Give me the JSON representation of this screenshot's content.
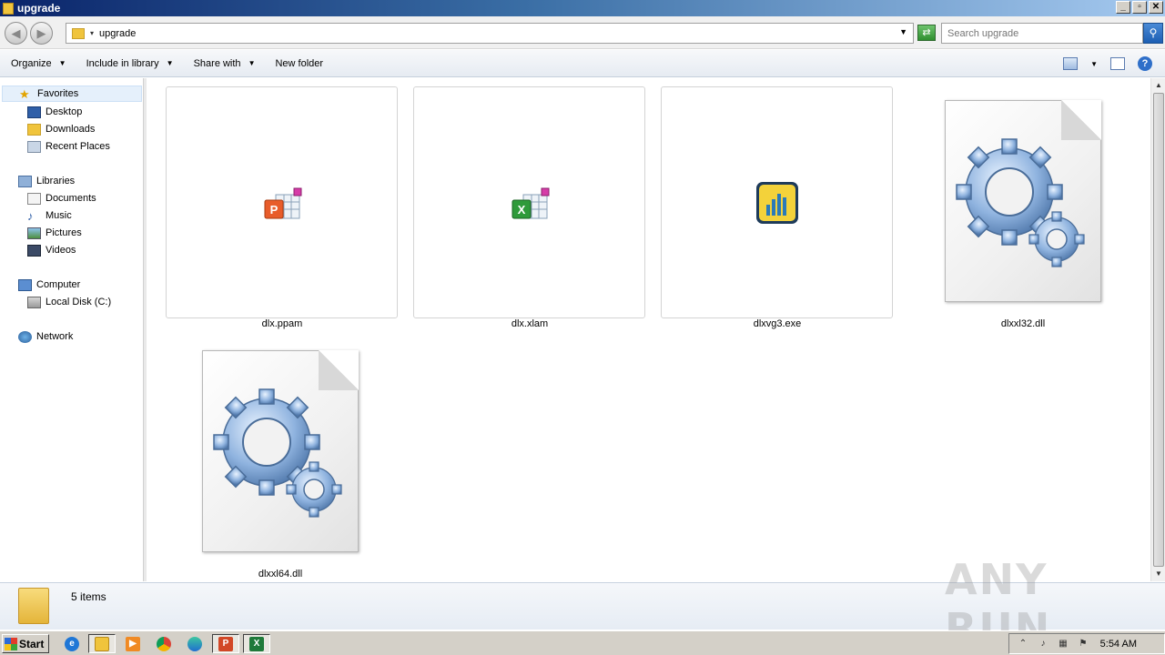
{
  "window": {
    "title": "upgrade"
  },
  "address": {
    "path": "upgrade"
  },
  "search": {
    "placeholder": "Search upgrade"
  },
  "toolbar": {
    "organize": "Organize",
    "include_in_library": "Include in library",
    "share_with": "Share with",
    "new_folder": "New folder"
  },
  "nav": {
    "favorites": "Favorites",
    "desktop": "Desktop",
    "downloads": "Downloads",
    "recent_places": "Recent Places",
    "libraries": "Libraries",
    "documents": "Documents",
    "music": "Music",
    "pictures": "Pictures",
    "videos": "Videos",
    "computer": "Computer",
    "local_disk": "Local Disk (C:)",
    "network": "Network"
  },
  "files": [
    {
      "name": "dlx.ppam",
      "icon": "powerpoint-addin-icon"
    },
    {
      "name": "dlx.xlam",
      "icon": "excel-addin-icon"
    },
    {
      "name": "dlxvg3.exe",
      "icon": "chart-app-icon"
    },
    {
      "name": "dlxxl32.dll",
      "icon": "dll-gear-icon"
    },
    {
      "name": "dlxxl64.dll",
      "icon": "dll-gear-icon"
    }
  ],
  "details": {
    "count": "5 items"
  },
  "watermark": "ANY RUN",
  "taskbar": {
    "start": "Start",
    "clock": "5:54 AM"
  },
  "colors": {
    "titlebar": "#0a246a",
    "selection": "#e5f0fb",
    "taskbar": "#d4d0c8"
  }
}
